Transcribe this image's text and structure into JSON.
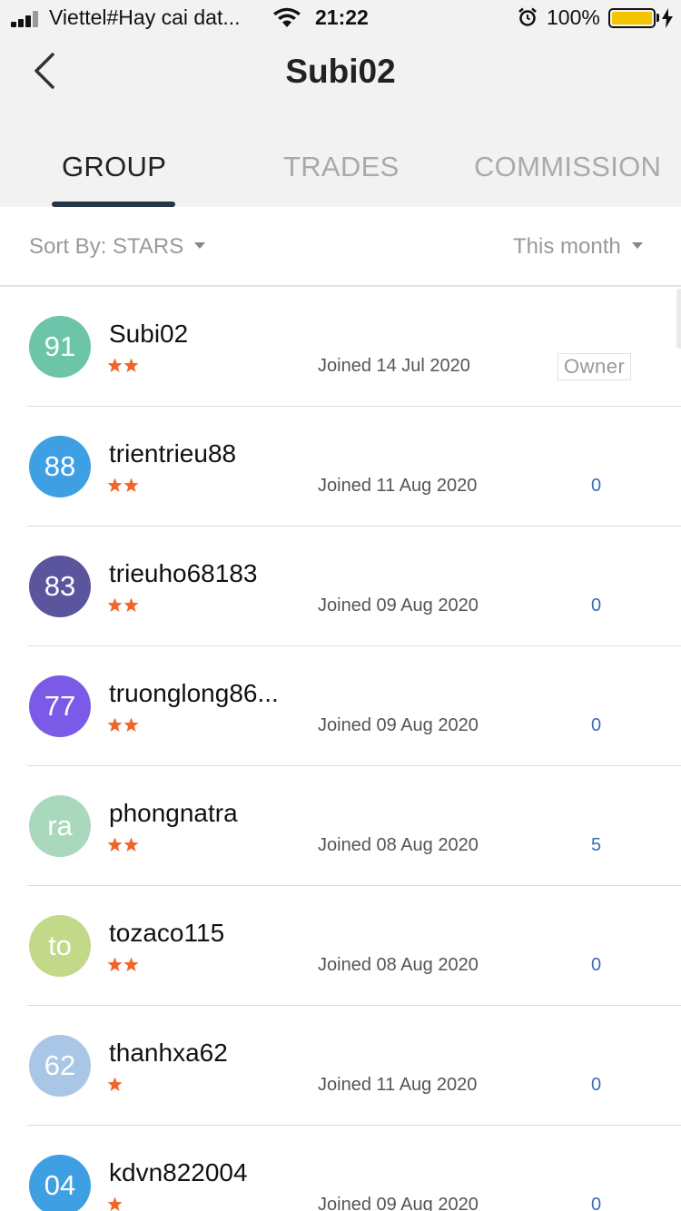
{
  "status_bar": {
    "carrier": "Viettel#Hay cai dat...",
    "time": "21:22",
    "battery_percent": "100%",
    "battery_color": "#f5c400"
  },
  "nav": {
    "back_icon": "chevron-left-icon",
    "title": "Subi02"
  },
  "tabs": [
    {
      "label": "GROUP",
      "active": true
    },
    {
      "label": "TRADES",
      "active": false
    },
    {
      "label": "COMMISSION",
      "active": false
    }
  ],
  "sort": {
    "label": "Sort By: STARS",
    "period": "This month"
  },
  "members": [
    {
      "avatar": "91",
      "color": "#6cc4a9",
      "name": "Subi02",
      "stars": 2,
      "joined": "Joined 14 Jul 2020",
      "badge": "Owner"
    },
    {
      "avatar": "88",
      "color": "#3f9fe3",
      "name": "trientrieu88",
      "stars": 2,
      "joined": "Joined 11 Aug 2020",
      "value": "0"
    },
    {
      "avatar": "83",
      "color": "#5b559e",
      "name": "trieuho68183",
      "stars": 2,
      "joined": "Joined 09 Aug 2020",
      "value": "0"
    },
    {
      "avatar": "77",
      "color": "#7a5ae6",
      "name": "truonglong86...",
      "stars": 2,
      "joined": "Joined 09 Aug 2020",
      "value": "0"
    },
    {
      "avatar": "ra",
      "color": "#a9d8bd",
      "name": "phongnatra",
      "stars": 2,
      "joined": "Joined 08 Aug 2020",
      "value": "5"
    },
    {
      "avatar": "to",
      "color": "#c3d98a",
      "name": "tozaco115",
      "stars": 2,
      "joined": "Joined 08 Aug 2020",
      "value": "0"
    },
    {
      "avatar": "62",
      "color": "#a9c6e6",
      "name": "thanhxa62",
      "stars": 1,
      "joined": "Joined 11 Aug 2020",
      "value": "0"
    },
    {
      "avatar": "04",
      "color": "#3f9fe3",
      "name": "kdvn822004",
      "stars": 1,
      "joined": "Joined 09 Aug 2020",
      "value": "0"
    }
  ],
  "colors": {
    "star": "#f0652c",
    "link_value": "#3a6bbd",
    "tab_underline": "#253545"
  }
}
